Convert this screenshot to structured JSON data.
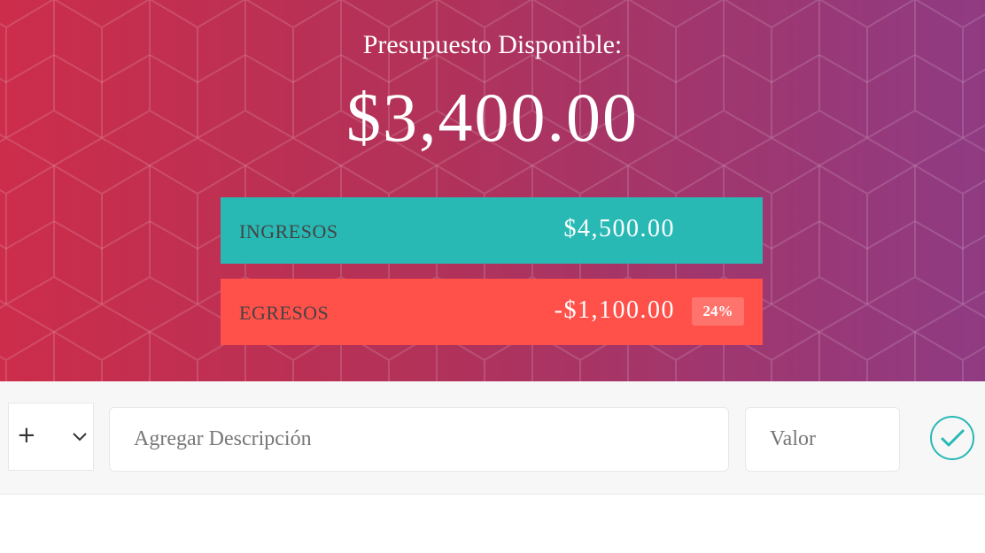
{
  "header": {
    "title": "Presupuesto Disponible:",
    "budget": "$3,400.00"
  },
  "income": {
    "label": "INGRESOS",
    "value": "$4,500.00",
    "color": "#28b9b5"
  },
  "expenses": {
    "label": "EGRESOS",
    "value": "-$1,100.00",
    "percentage": "24%",
    "color": "#ff5049"
  },
  "form": {
    "type_selected": "+",
    "description_placeholder": "Agregar Descripción",
    "value_placeholder": "Valor",
    "submit_icon": "check-circle-icon"
  },
  "theme": {
    "gradient_start": "#cc2d4a",
    "gradient_end": "#8f3b83",
    "accent": "#28b9b5"
  }
}
